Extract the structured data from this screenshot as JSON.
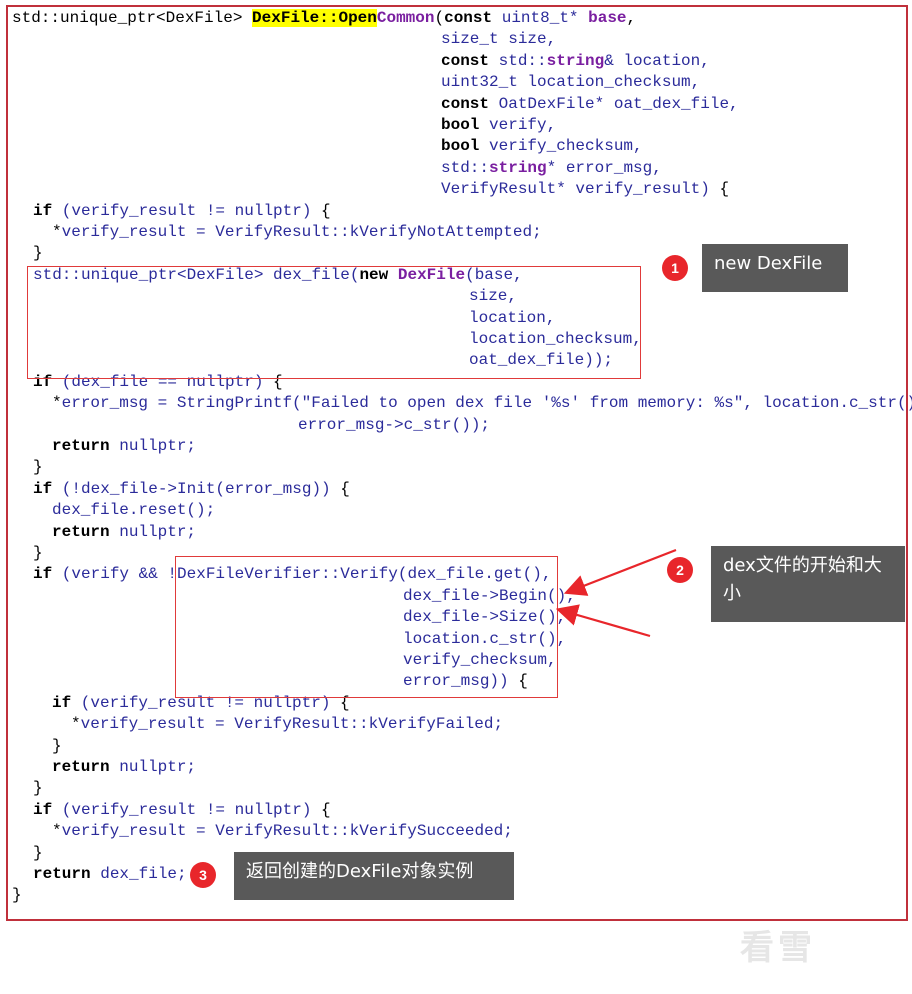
{
  "code_lines": [
    {
      "spans": [
        {
          "c": "pu",
          "t": "std::unique_ptr<DexFile> "
        },
        {
          "c": "hl",
          "t": "DexFile::Open"
        },
        {
          "c": "fn",
          "t": "Common"
        },
        {
          "c": "pu",
          "t": "("
        },
        {
          "c": "kw",
          "t": "const"
        },
        {
          "c": "st",
          "t": " uint8_t* "
        },
        {
          "c": "ty",
          "t": "base"
        },
        {
          "c": "pu",
          "t": ","
        }
      ]
    },
    {
      "spans": [
        {
          "c": "st",
          "t": "size_t size,"
        }
      ]
    },
    {
      "spans": [
        {
          "c": "kw",
          "t": "const"
        },
        {
          "c": "st",
          "t": " std::"
        },
        {
          "c": "ty",
          "t": "string"
        },
        {
          "c": "st",
          "t": "& location,"
        }
      ]
    },
    {
      "spans": [
        {
          "c": "st",
          "t": "uint32_t location_checksum,"
        }
      ]
    },
    {
      "spans": [
        {
          "c": "kw",
          "t": "const"
        },
        {
          "c": "st",
          "t": " OatDexFile* oat_dex_file,"
        }
      ]
    },
    {
      "spans": [
        {
          "c": "kw",
          "t": "bool"
        },
        {
          "c": "st",
          "t": " verify,"
        }
      ]
    },
    {
      "spans": [
        {
          "c": "kw",
          "t": "bool"
        },
        {
          "c": "st",
          "t": " verify_checksum,"
        }
      ]
    },
    {
      "spans": [
        {
          "c": "st",
          "t": "std::"
        },
        {
          "c": "ty",
          "t": "string"
        },
        {
          "c": "st",
          "t": "* error_msg,"
        }
      ]
    },
    {
      "spans": [
        {
          "c": "st",
          "t": "VerifyResult* verify_result) "
        },
        {
          "c": "pu",
          "t": "{"
        }
      ]
    },
    {
      "spans": [
        {
          "c": "kw",
          "t": "if"
        },
        {
          "c": "st",
          "t": " (verify_result != nullptr) "
        },
        {
          "c": "pu",
          "t": "{"
        }
      ]
    },
    {
      "spans": [
        {
          "c": "pu",
          "t": "*"
        },
        {
          "c": "st",
          "t": "verify_result = VerifyResult::kVerifyNotAttempted;"
        }
      ]
    },
    {
      "spans": [
        {
          "c": "pu",
          "t": "}"
        }
      ]
    },
    {
      "spans": [
        {
          "c": "st",
          "t": "std::unique_ptr<DexFile> dex_file("
        },
        {
          "c": "kw",
          "t": "new"
        },
        {
          "c": "st",
          "t": " "
        },
        {
          "c": "ty",
          "t": "DexFile"
        },
        {
          "c": "st",
          "t": "(base,"
        }
      ]
    },
    {
      "spans": [
        {
          "c": "st",
          "t": "size,"
        }
      ]
    },
    {
      "spans": [
        {
          "c": "st",
          "t": "location,"
        }
      ]
    },
    {
      "spans": [
        {
          "c": "st",
          "t": "location_checksum,"
        }
      ]
    },
    {
      "spans": [
        {
          "c": "st",
          "t": "oat_dex_file));"
        }
      ]
    },
    {
      "spans": [
        {
          "c": "kw",
          "t": "if"
        },
        {
          "c": "st",
          "t": " (dex_file == nullptr) "
        },
        {
          "c": "pu",
          "t": "{"
        }
      ]
    },
    {
      "spans": [
        {
          "c": "pu",
          "t": "*"
        },
        {
          "c": "st",
          "t": "error_msg = StringPrintf(\"Failed to open dex file '%s' from memory: %s\", location.c_str()"
        }
      ]
    },
    {
      "spans": [
        {
          "c": "st",
          "t": "error_msg->c_str());"
        }
      ]
    },
    {
      "spans": [
        {
          "c": "kw",
          "t": "return"
        },
        {
          "c": "st",
          "t": " nullptr;"
        }
      ]
    },
    {
      "spans": [
        {
          "c": "pu",
          "t": "}"
        }
      ]
    },
    {
      "spans": [
        {
          "c": "kw",
          "t": "if"
        },
        {
          "c": "st",
          "t": " (!dex_file->Init(error_msg)) "
        },
        {
          "c": "pu",
          "t": "{"
        }
      ]
    },
    {
      "spans": [
        {
          "c": "st",
          "t": "dex_file.reset();"
        }
      ]
    },
    {
      "spans": [
        {
          "c": "kw",
          "t": "return"
        },
        {
          "c": "st",
          "t": " nullptr;"
        }
      ]
    },
    {
      "spans": [
        {
          "c": "pu",
          "t": "}"
        }
      ]
    },
    {
      "spans": [
        {
          "c": "kw",
          "t": "if"
        },
        {
          "c": "st",
          "t": " (verify && !DexFileVerifier::Verify(dex_file.get(),"
        }
      ]
    },
    {
      "spans": [
        {
          "c": "st",
          "t": "dex_file->Begin(),"
        }
      ]
    },
    {
      "spans": [
        {
          "c": "st",
          "t": "dex_file->Size(),"
        }
      ]
    },
    {
      "spans": [
        {
          "c": "st",
          "t": "location.c_str(),"
        }
      ]
    },
    {
      "spans": [
        {
          "c": "st",
          "t": "verify_checksum,"
        }
      ]
    },
    {
      "spans": [
        {
          "c": "st",
          "t": "error_msg)) "
        },
        {
          "c": "pu",
          "t": "{"
        }
      ]
    },
    {
      "spans": [
        {
          "c": "kw",
          "t": "if"
        },
        {
          "c": "st",
          "t": " (verify_result != nullptr) "
        },
        {
          "c": "pu",
          "t": "{"
        }
      ]
    },
    {
      "spans": [
        {
          "c": "pu",
          "t": "*"
        },
        {
          "c": "st",
          "t": "verify_result = VerifyResult::kVerifyFailed;"
        }
      ]
    },
    {
      "spans": [
        {
          "c": "pu",
          "t": "}"
        }
      ]
    },
    {
      "spans": [
        {
          "c": "kw",
          "t": "return"
        },
        {
          "c": "st",
          "t": " nullptr;"
        }
      ]
    },
    {
      "spans": [
        {
          "c": "pu",
          "t": "}"
        }
      ]
    },
    {
      "spans": [
        {
          "c": "kw",
          "t": "if"
        },
        {
          "c": "st",
          "t": " (verify_result != nullptr) "
        },
        {
          "c": "pu",
          "t": "{"
        }
      ]
    },
    {
      "spans": [
        {
          "c": "pu",
          "t": "*"
        },
        {
          "c": "st",
          "t": "verify_result = VerifyResult::kVerifySucceeded;"
        }
      ]
    },
    {
      "spans": [
        {
          "c": "pu",
          "t": "}"
        }
      ]
    },
    {
      "spans": [
        {
          "c": "kw",
          "t": "return"
        },
        {
          "c": "st",
          "t": " dex_file;"
        }
      ]
    },
    {
      "spans": [
        {
          "c": "pu",
          "t": "}"
        }
      ]
    }
  ],
  "annotations": {
    "a1": {
      "num": "1",
      "text": "new DexFile"
    },
    "a2": {
      "num": "2",
      "text": "dex文件的开始和大小"
    },
    "a3": {
      "num": "3",
      "text": "返回创建的DexFile对象实例"
    }
  },
  "watermark": "看雪",
  "colors": {
    "highlight": "#ffff00",
    "box_red": "#e03a3a",
    "callout_bg": "#595959",
    "badge_red": "#e8262b"
  }
}
